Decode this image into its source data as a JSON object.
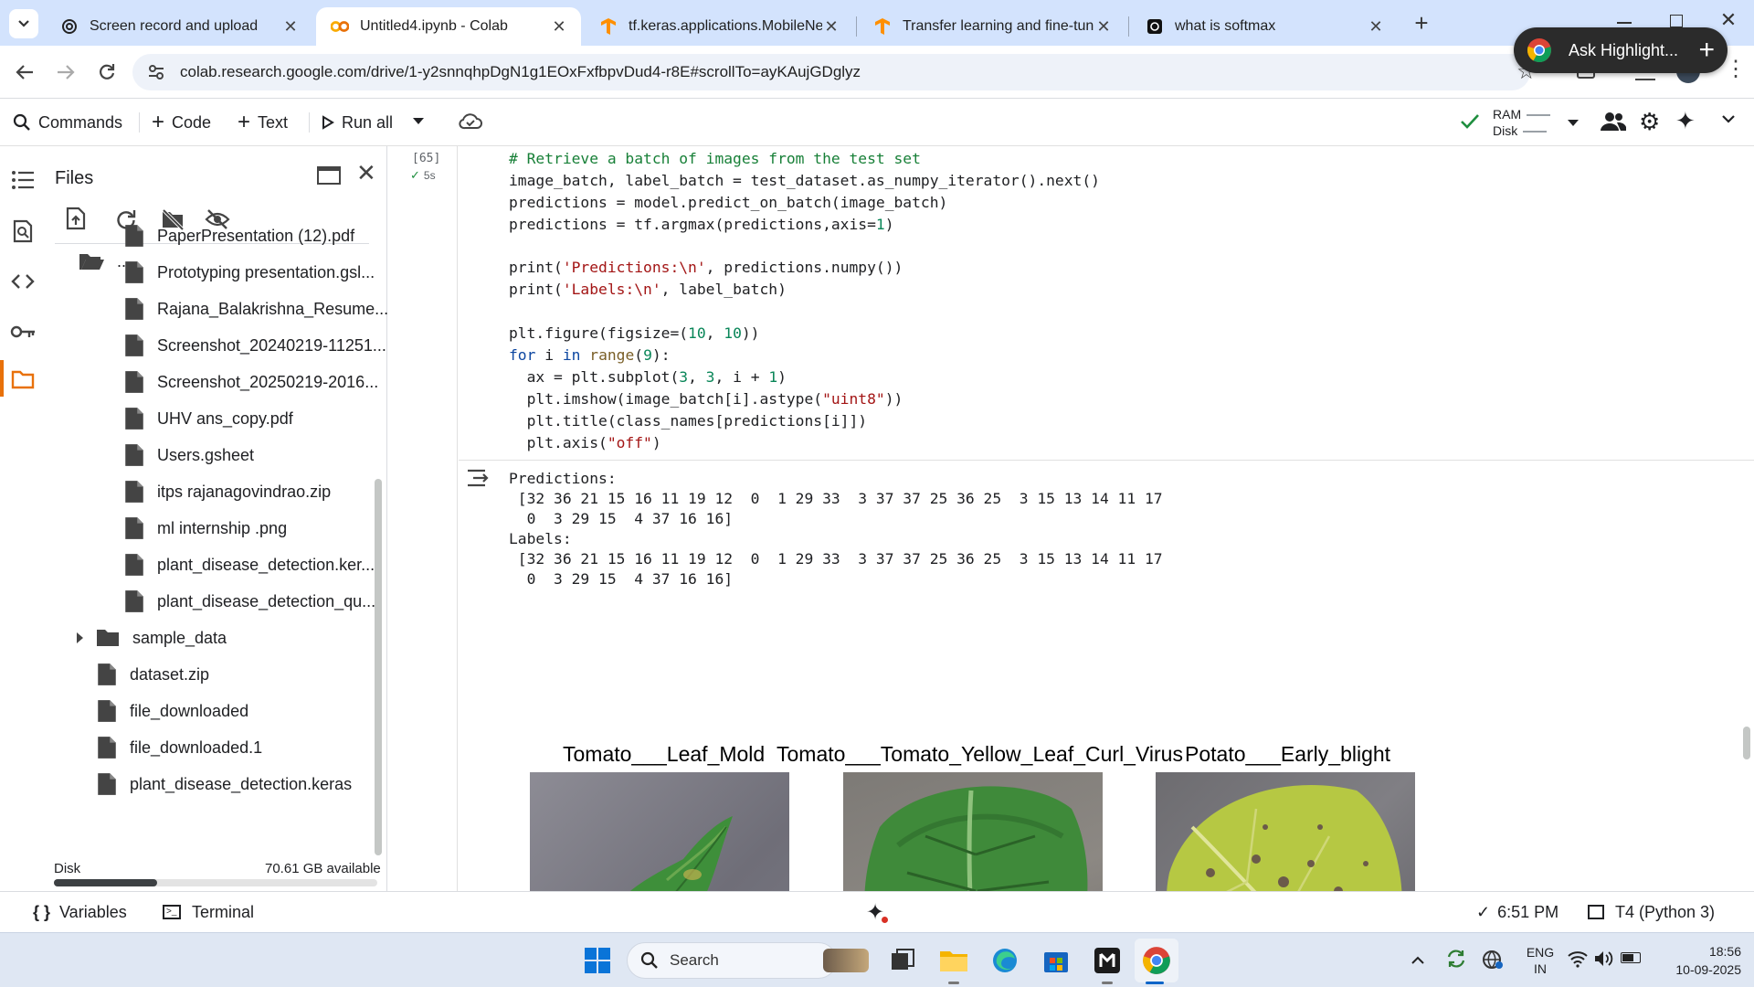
{
  "browser": {
    "tabs": [
      {
        "title": "Screen record and upload",
        "active": false
      },
      {
        "title": "Untitled4.ipynb - Colab",
        "active": true
      },
      {
        "title": "tf.keras.applications.MobileNetV",
        "active": false
      },
      {
        "title": "Transfer learning and fine-tunin",
        "active": false
      },
      {
        "title": "what is softmax",
        "active": false
      }
    ],
    "url": "colab.research.google.com/drive/1-y2snnqhpDgN1g1EOxFxfbpvDud4-r8E#scrollTo=ayKAujGDglyz",
    "ask_pill": "Ask Highlight..."
  },
  "colab_toolbar": {
    "commands": "Commands",
    "code": "Code",
    "text": "Text",
    "run_all": "Run all",
    "ram": "RAM",
    "disk": "Disk"
  },
  "files": {
    "title": "Files",
    "parent": "..",
    "items": [
      "PaperPresentation (12).pdf",
      "Prototyping presentation.gsl...",
      "Rajana_Balakrishna_Resume...",
      "Screenshot_20240219-11251...",
      "Screenshot_20250219-2016...",
      "UHV ans_copy.pdf",
      "Users.gsheet",
      "itps rajanagovindrao.zip",
      "ml internship .png",
      "plant_disease_detection.ker...",
      "plant_disease_detection_qu..."
    ],
    "root_items": [
      {
        "name": "sample_data",
        "type": "folder"
      },
      {
        "name": "dataset.zip",
        "type": "file"
      },
      {
        "name": "file_downloaded",
        "type": "file"
      },
      {
        "name": "file_downloaded.1",
        "type": "file"
      },
      {
        "name": "plant_disease_detection.keras",
        "type": "file"
      }
    ],
    "disk_label": "Disk",
    "disk_available": "70.61 GB available",
    "disk_used_fraction": 0.32
  },
  "cell": {
    "exec_count": "[65]",
    "exec_time": "5s",
    "code_lines": [
      "# Retrieve a batch of images from the test set",
      "image_batch, label_batch = test_dataset.as_numpy_iterator().next()",
      "predictions = model.predict_on_batch(image_batch)",
      "predictions = tf.argmax(predictions,axis=1)",
      "",
      "print('Predictions:\\n', predictions.numpy())",
      "print('Labels:\\n', label_batch)",
      "",
      "plt.figure(figsize=(10, 10))",
      "for i in range(9):",
      "  ax = plt.subplot(3, 3, i + 1)",
      "  plt.imshow(image_batch[i].astype(\"uint8\"))",
      "  plt.title(class_names[predictions[i]])",
      "  plt.axis(\"off\")"
    ],
    "output_lines": [
      "Predictions:",
      " [32 36 21 15 16 11 19 12  0  1 29 33  3 37 37 25 36 25  3 15 13 14 11 17",
      "  0  3 29 15  4 37 16 16]",
      "Labels:",
      " [32 36 21 15 16 11 19 12  0  1 29 33  3 37 37 25 36 25  3 15 13 14 11 17",
      "  0  3 29 15  4 37 16 16]"
    ],
    "plot_titles": [
      "Tomato___Leaf_Mold",
      "Tomato___Tomato_Yellow_Leaf_Curl_Virus",
      "Potato___Early_blight"
    ]
  },
  "statusbar": {
    "variables": "Variables",
    "terminal": "Terminal",
    "time": "6:51 PM",
    "runtime": "T4 (Python 3)"
  },
  "taskbar": {
    "search_placeholder": "Search",
    "lang_top": "ENG",
    "lang_bottom": "IN",
    "clock_time": "18:56",
    "clock_date": "10-09-2025"
  },
  "colors": {
    "tabstrip_bg": "#d3e3fd",
    "colab_orange": "#f9ab00",
    "accent_orange": "#e8710a",
    "check_green": "#1e8e3e"
  }
}
